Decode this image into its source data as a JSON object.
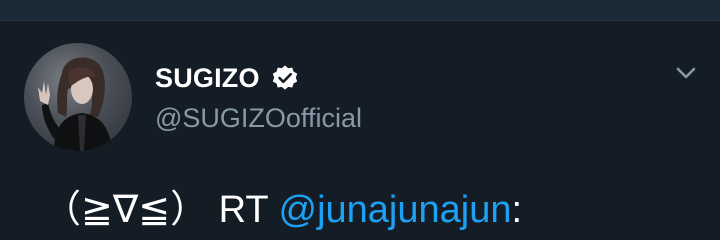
{
  "tweet": {
    "author": {
      "display_name": "SUGIZO",
      "handle": "@SUGIZOofficial",
      "verified": true
    },
    "text": {
      "prefix": "（≧∇≦） RT ",
      "mention": "@junajunajun",
      "suffix": ":"
    }
  },
  "icons": {
    "verified": "verified-badge-icon",
    "menu": "chevron-down-icon",
    "avatar": "profile-photo"
  },
  "colors": {
    "background": "#141d26",
    "top_bar": "#1b2836",
    "name": "#ffffff",
    "handle": "#8899a6",
    "mention": "#1da1f2"
  }
}
